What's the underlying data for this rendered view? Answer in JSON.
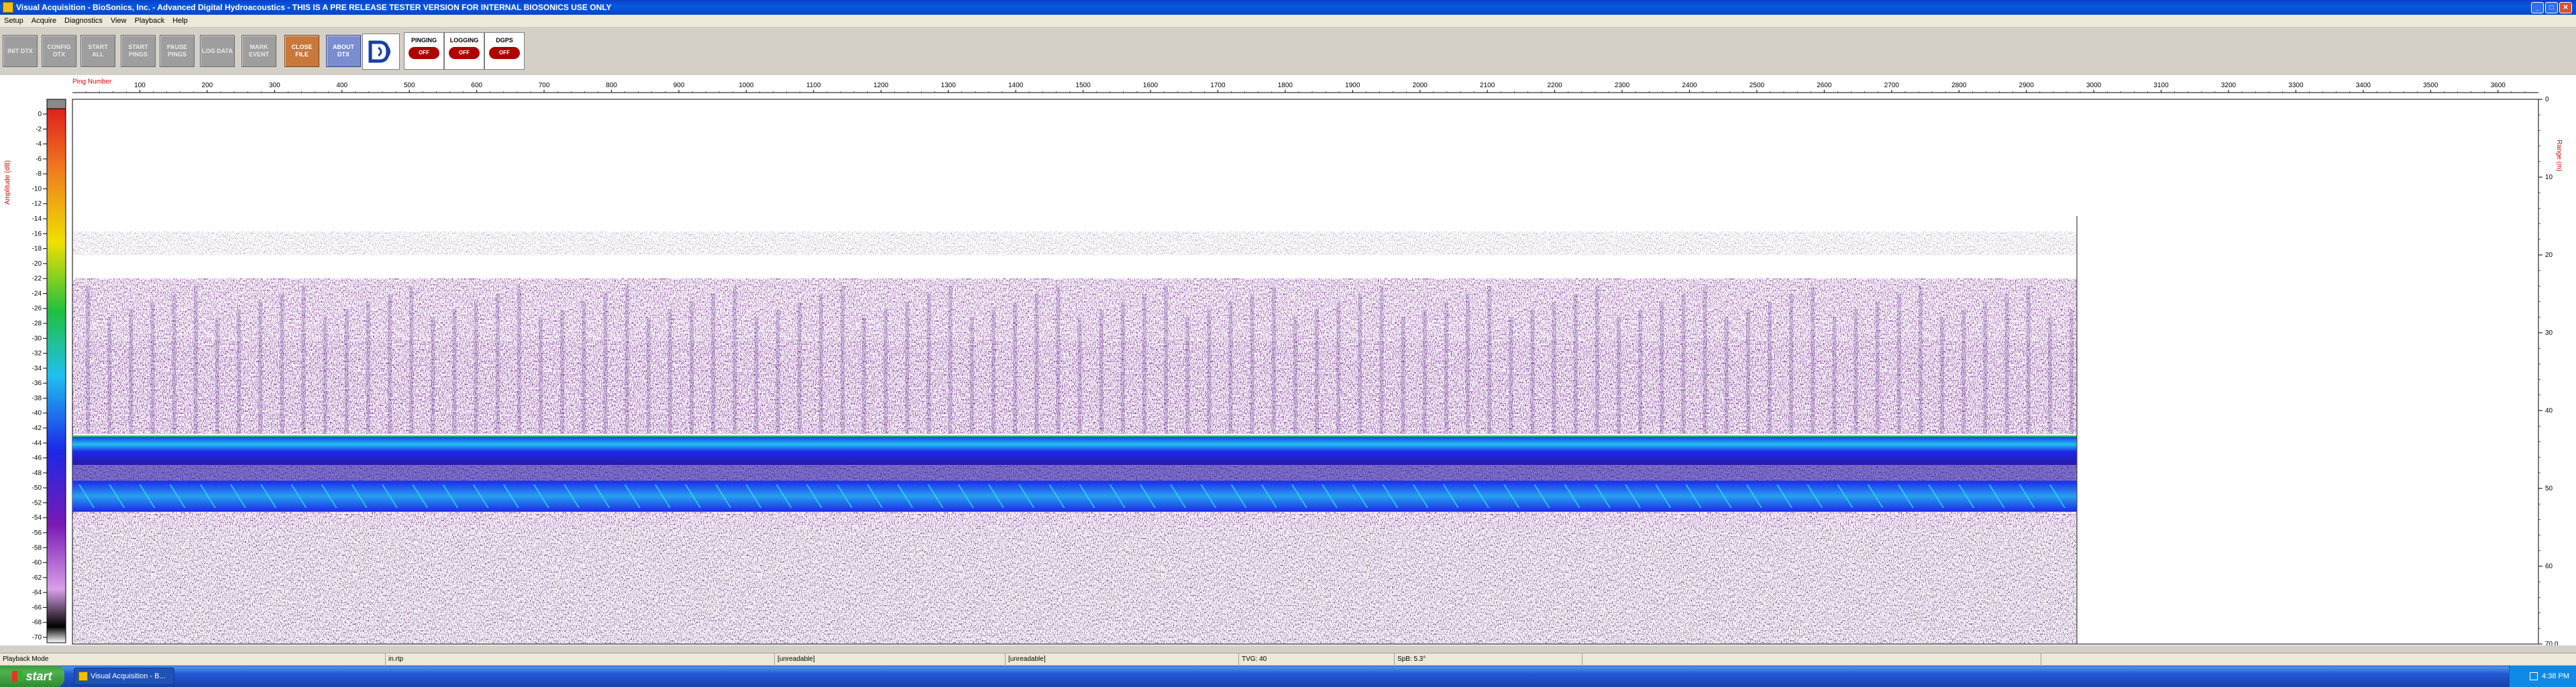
{
  "window": {
    "title": "Visual Acquisition  -  BioSonics, Inc.  -  Advanced Digital Hydroacoustics  -  THIS IS A PRE RELEASE TESTER VERSION FOR INTERNAL BIOSONICS USE ONLY",
    "min_icon": "minimize-icon",
    "max_icon": "maximize-icon",
    "close_icon": "close-icon"
  },
  "menu": [
    "Setup",
    "Acquire",
    "Diagnostics",
    "View",
    "Playback",
    "Help"
  ],
  "toolbar": {
    "buttons": [
      {
        "label": "INIT DTX",
        "name": "init-dtx-button"
      },
      {
        "label": "CONFIG DTX",
        "name": "config-dtx-button"
      },
      {
        "label": "START ALL",
        "name": "start-all-button"
      },
      {
        "label": "START PINGS",
        "name": "start-pings-button"
      },
      {
        "label": "PAUSE PINGS",
        "name": "pause-pings-button"
      },
      {
        "label": "LOG DATA",
        "name": "log-data-button"
      },
      {
        "label": "MARK EVENT",
        "name": "mark-event-button"
      },
      {
        "label": "CLOSE FILE",
        "name": "close-file-button"
      },
      {
        "label": "ABOUT DTX",
        "name": "about-dtx-button"
      }
    ],
    "logo_icon": "biosonics-logo-icon",
    "status": [
      {
        "label": "PINGING",
        "value": "OFF"
      },
      {
        "label": "LOGGING",
        "value": "OFF"
      },
      {
        "label": "DGPS",
        "value": "OFF"
      }
    ]
  },
  "echogram": {
    "ping_label": "Ping Number",
    "amplitude_label": "Amplitude (dB)",
    "range_label": "Range (m)",
    "ping_ticks": [
      "100",
      "200",
      "300",
      "400",
      "500",
      "600",
      "700",
      "800",
      "900",
      "1000",
      "1100",
      "1200",
      "1300",
      "1400",
      "1500",
      "1600",
      "1700",
      "1800",
      "1900",
      "2000",
      "2100",
      "2200",
      "2300",
      "2400",
      "2500",
      "2600",
      "2700",
      "2800",
      "2900",
      "3000",
      "3100",
      "3200",
      "3300",
      "3400",
      "3500",
      "3600"
    ],
    "amplitude_ticks": [
      "0",
      "-2",
      "-4",
      "-6",
      "-8",
      "-10",
      "-12",
      "-14",
      "-16",
      "-18",
      "-20",
      "-22",
      "-24",
      "-26",
      "-28",
      "-30",
      "-32",
      "-34",
      "-36",
      "-38",
      "-40",
      "-42",
      "-44",
      "-46",
      "-48",
      "-50",
      "-52",
      "-54",
      "-56",
      "-58",
      "-60",
      "-62",
      "-64",
      "-66",
      "-68",
      "-70"
    ],
    "range_ticks": [
      "0",
      "10",
      "20",
      "30",
      "40",
      "50",
      "60",
      "70.0"
    ],
    "ping_min": 0,
    "ping_max": 3660,
    "data_last_ping": 2975,
    "range_max": 70.0,
    "colors": {
      "scale_top": "#8a8a8a",
      "red": "#e0201c",
      "orange": "#f08020",
      "yellow": "#f0e000",
      "green": "#20c040",
      "cyan": "#20c0f0",
      "blue": "#1c28e8",
      "purple": "#7a1ab4",
      "magenta": "#d8a0e8",
      "black": "#000000",
      "axis_red": "#e00000"
    }
  },
  "status_bar": [
    "Playback Mode",
    "in.rtp",
    "[unreadable]",
    "[unreadable]",
    "TVG: 40",
    "SpB: 5.3°",
    "",
    ""
  ],
  "taskbar": {
    "start_label": "start",
    "window_label": "Visual Acquisition - B...",
    "clock": "4:38 PM"
  }
}
